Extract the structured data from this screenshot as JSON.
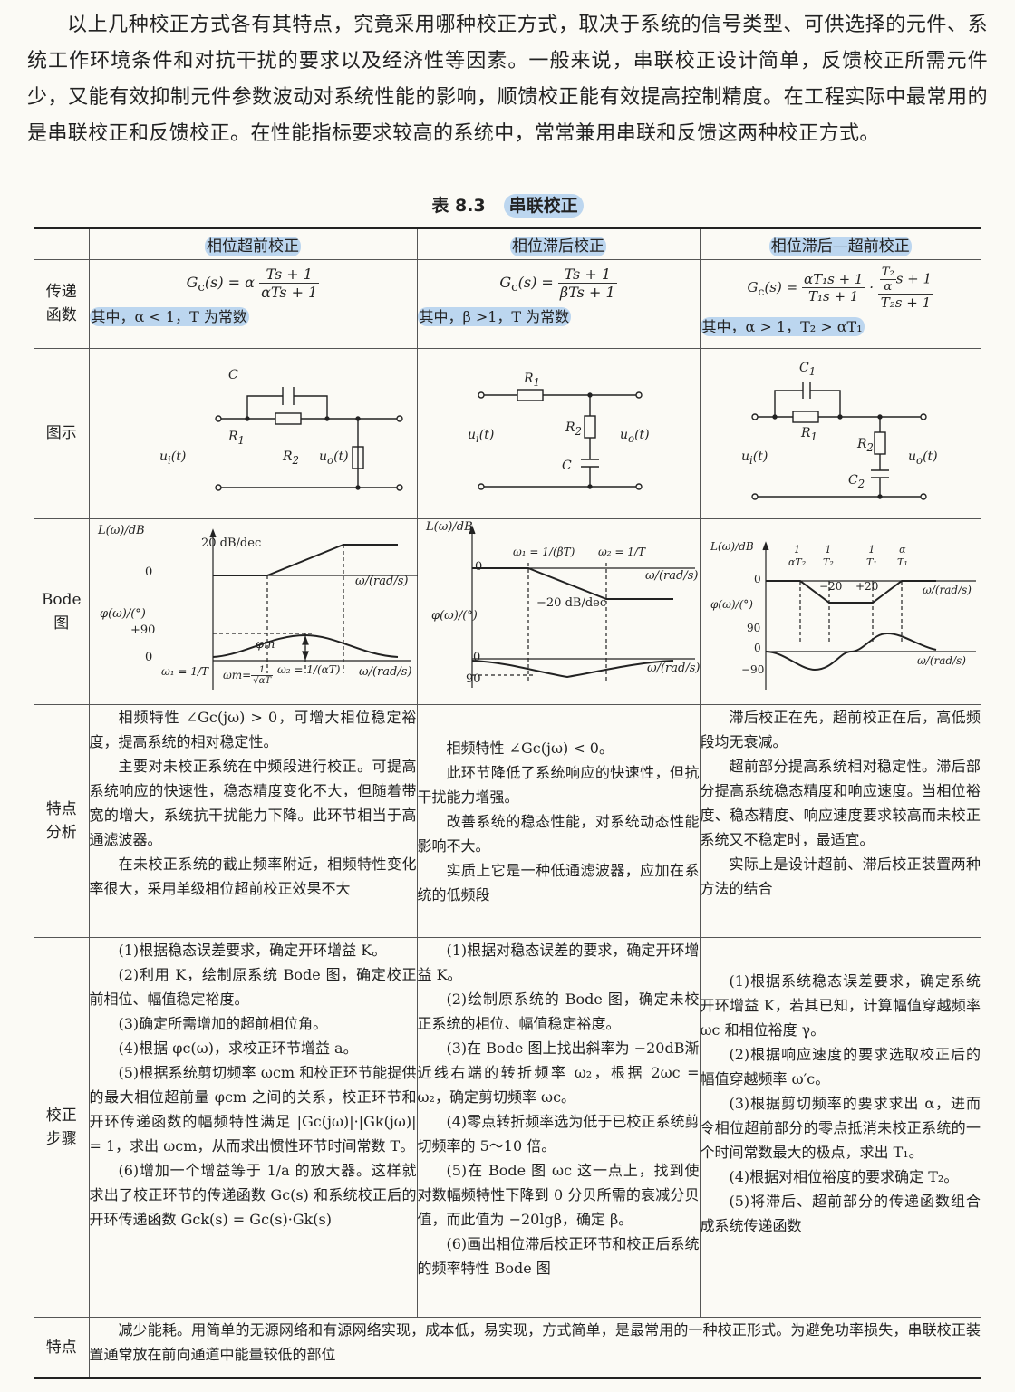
{
  "intro": "以上几种校正方式各有其特点，究竟采用哪种校正方式，取决于系统的信号类型、可供选择的元件、系统工作环境条件和对抗干扰的要求以及经济性等因素。一般来说，串联校正设计简单，反馈校正所需元件少，又能有效抑制元件参数波动对系统性能的影响，顺馈校正能有效提高控制精度。在工程实际中最常用的是串联校正和反馈校正。在性能指标要求较高的系统中，常常兼用串联和反馈这两种校正方式。",
  "caption": {
    "number": "表 8.3",
    "title": "串联校正"
  },
  "columns": [
    "相位超前校正",
    "相位滞后校正",
    "相位滞后—超前校正"
  ],
  "row_labels": {
    "transfer": [
      "传递",
      "函数"
    ],
    "diagram": "图示",
    "bode": [
      "Bode",
      "图"
    ],
    "analysis": [
      "特点",
      "分析"
    ],
    "steps": [
      "校正",
      "步骤"
    ],
    "feature": "特点"
  },
  "transfer": {
    "lead": {
      "lhs": "G",
      "sub": "c",
      "arg": "(s) = α",
      "num": "Ts + 1",
      "den": "αTs + 1",
      "cond": "其中，α < 1，T 为常数"
    },
    "lag": {
      "lhs": "G",
      "sub": "c",
      "arg": "(s) =",
      "num": "Ts + 1",
      "den": "βTs + 1",
      "cond": "其中，β >1，T 为常数"
    },
    "laglead": {
      "lhs": "G",
      "sub": "c",
      "arg": "(s) =",
      "num1": "αT₁s + 1",
      "den1": "T₁s + 1",
      "dot": "·",
      "num2a": "T₂",
      "num2b": "α",
      "num2c": "s + 1",
      "den2": "T₂s + 1",
      "cond": "其中，α > 1，T₂ > αT₁"
    }
  },
  "circuits": {
    "lead": {
      "C": "C",
      "R1": "R",
      "R1sub": "1",
      "R2": "R",
      "R2sub": "2",
      "ui": "u",
      "uisub": "i",
      "uiarg": "(t)",
      "uo": "u",
      "uosub": "o",
      "uoarg": "(t)"
    },
    "lag": {
      "R1": "R",
      "R1sub": "1",
      "R2": "R",
      "R2sub": "2",
      "C": "C",
      "ui": "u",
      "uisub": "i",
      "uiarg": "(t)",
      "uo": "u",
      "uosub": "o",
      "uoarg": "(t)"
    },
    "laglead": {
      "C1": "C",
      "C1sub": "1",
      "R1": "R",
      "R1sub": "1",
      "R2": "R",
      "R2sub": "2",
      "C2": "C",
      "C2sub": "2",
      "ui": "u",
      "uisub": "i",
      "uiarg": "(t)",
      "uo": "u",
      "uosub": "o",
      "uoarg": "(t)"
    }
  },
  "bode": {
    "lead": {
      "L": "L(ω)/dB",
      "slope": "20 dB/dec",
      "zero": "0",
      "omega": "ω/(rad/s)",
      "phi": "φ(ω)/(°)",
      "p90": "+90",
      "zero2": "0",
      "phim": "φm",
      "w1": "ω₁ = 1/T",
      "wm": "ωm=",
      "wmfrac_n": "1",
      "wmfrac_d": "√αT",
      "w2": "ω₂ = 1/(αT)",
      "omega2": "ω/(rad/s)"
    },
    "lag": {
      "L": "L(ω)/dB",
      "zero": "0",
      "w1": "ω₁ = 1/(βT)",
      "w2": "ω₂ = 1/T",
      "omega": "ω/(rad/s)",
      "slope": "−20 dB/dec",
      "phi": "φ(ω)/(°)",
      "zero2": "0",
      "m90": "90",
      "omega2": "ω/(rad/s)"
    },
    "laglead": {
      "L": "L(ω)/dB",
      "f1n": "1",
      "f1d": "αT₂",
      "f2n": "1",
      "f2d": "T₂",
      "f3n": "1",
      "f3d": "T₁",
      "f4n": "α",
      "f4d": "T₁",
      "zero": "0",
      "s1": "−20",
      "s2": "+20",
      "omega": "ω/(rad/s)",
      "phi": "φ(ω)/(°)",
      "p90": "90",
      "zero2": "0",
      "m90": "−90",
      "omega2": "ω/(rad/s)"
    }
  },
  "analysis": {
    "lead": [
      "相频特性 ∠Gc(jω) > 0，可增大相位稳定裕度，提高系统的相对稳定性。",
      "主要对未校正系统在中频段进行校正。可提高系统响应的快速性，稳态精度变化不大，但随着带宽的增大，系统抗干扰能力下降。此环节相当于高通滤波器。",
      "在未校正系统的截止频率附近，相频特性变化率很大，采用单级相位超前校正效果不大"
    ],
    "lag": [
      "相频特性 ∠Gc(jω) < 0。",
      "此环节降低了系统响应的快速性，但抗干扰能力增强。",
      "改善系统的稳态性能，对系统动态性能影响不大。",
      "实质上它是一种低通滤波器，应加在系统的低频段"
    ],
    "laglead": [
      "滞后校正在先，超前校正在后，高低频段均无衰减。",
      "超前部分提高系统相对稳定性。滞后部分提高系统稳态精度和响应速度。当相位裕度、稳态精度、响应速度要求较高而未校正系统又不稳定时，最适宜。",
      "实际上是设计超前、滞后校正装置两种方法的结合"
    ]
  },
  "steps": {
    "lead": [
      "(1)根据稳态误差要求，确定开环增益 K。",
      "(2)利用 K，绘制原系统 Bode 图，确定校正前相位、幅值稳定裕度。",
      "(3)确定所需增加的超前相位角。",
      "(4)根据 φc(ω)，求校正环节增益 a。",
      "(5)根据系统剪切频率 ωcm 和校正环节能提供的最大相位超前量 φcm 之间的关系，校正环节和开环传递函数的幅频特性满足 |Gc(jω)|·|Gk(jω)| = 1，求出 ωcm，从而求出惯性环节时间常数 T。",
      "(6)增加一个增益等于 1/a 的放大器。这样就求出了校正环节的传递函数 Gc(s) 和系统校正后的开环传递函数 Gck(s) = Gc(s)·Gk(s)"
    ],
    "lag": [
      "(1)根据对稳态误差的要求，确定开环增益 K。",
      "(2)绘制原系统的 Bode 图，确定未校正系统的相位、幅值稳定裕度。",
      "(3)在 Bode 图上找出斜率为 −20dB渐近线右端的转折频率 ω₂，根据 2ωc = ω₂，确定剪切频率 ωc。",
      "(4)零点转折频率选为低于已校正系统剪切频率的 5～10 倍。",
      "(5)在 Bode 图 ωc 这一点上，找到使对数幅频特性下降到 0 分贝所需的衰减分贝值，而此值为 −20lgβ，确定 β。",
      "(6)画出相位滞后校正环节和校正后系统的频率特性 Bode 图"
    ],
    "laglead": [
      "(1)根据系统稳态误差要求，确定系统开环增益 K，若其已知，计算幅值穿越频率 ωc 和相位裕度 γ。",
      "(2)根据响应速度的要求选取校正后的幅值穿越频率 ω′c。",
      "(3)根据剪切频率的要求求出 α，进而令相位超前部分的零点抵消未校正系统的一个时间常数最大的极点，求出 T₁。",
      "(4)根据对相位裕度的要求确定 T₂。",
      "(5)将滞后、超前部分的传递函数组合成系统传递函数"
    ]
  },
  "feature": "减少能耗。用简单的无源网络和有源网络实现，成本低，易实现，方式简单，是最常用的一种校正形式。为避免功率损失，串联校正装置通常放在前向通道中能量较低的部位",
  "colors": {
    "highlight": "#bcd6ef",
    "ink": "#222222",
    "paper": "#fbfaf5"
  }
}
